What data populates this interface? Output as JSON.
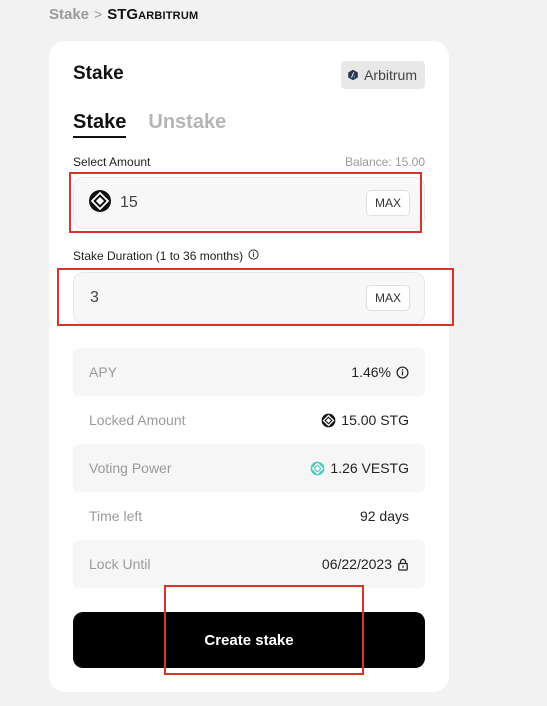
{
  "breadcrumb": {
    "root": "Stake",
    "separator": ">",
    "token": "STG",
    "chain": "ARBITRUM"
  },
  "card": {
    "title": "Stake",
    "network": "Arbitrum"
  },
  "tabs": [
    {
      "label": "Stake",
      "active": true
    },
    {
      "label": "Unstake",
      "active": false
    }
  ],
  "amount": {
    "label": "Select Amount",
    "balance": "Balance: 15.00",
    "value": "15",
    "max_label": "MAX",
    "token_icon": "stargate-icon"
  },
  "duration": {
    "label": "Stake Duration (1 to 36 months)",
    "value": "3",
    "max_label": "MAX",
    "info_icon": "info-icon"
  },
  "stats": [
    {
      "label": "APY",
      "value": "1.46%",
      "icon": "info-icon",
      "icon_position": "after"
    },
    {
      "label": "Locked Amount",
      "value": "15.00 STG",
      "icon": "stargate-icon",
      "icon_position": "before"
    },
    {
      "label": "Voting Power",
      "value": "1.26 VESTG",
      "icon": "vestg-icon",
      "icon_position": "before"
    },
    {
      "label": "Time left",
      "value": "92 days",
      "icon": "",
      "icon_position": ""
    },
    {
      "label": "Lock Until",
      "value": "06/22/2023",
      "icon": "lock-icon",
      "icon_position": "after"
    }
  ],
  "create_button": {
    "label": "Create stake"
  },
  "colors": {
    "page_bg": "#f2f2f2",
    "card_bg": "#ffffff",
    "button_bg": "#000000",
    "highlight": "#d9342b",
    "vestg_teal": "#4fc9b8"
  }
}
